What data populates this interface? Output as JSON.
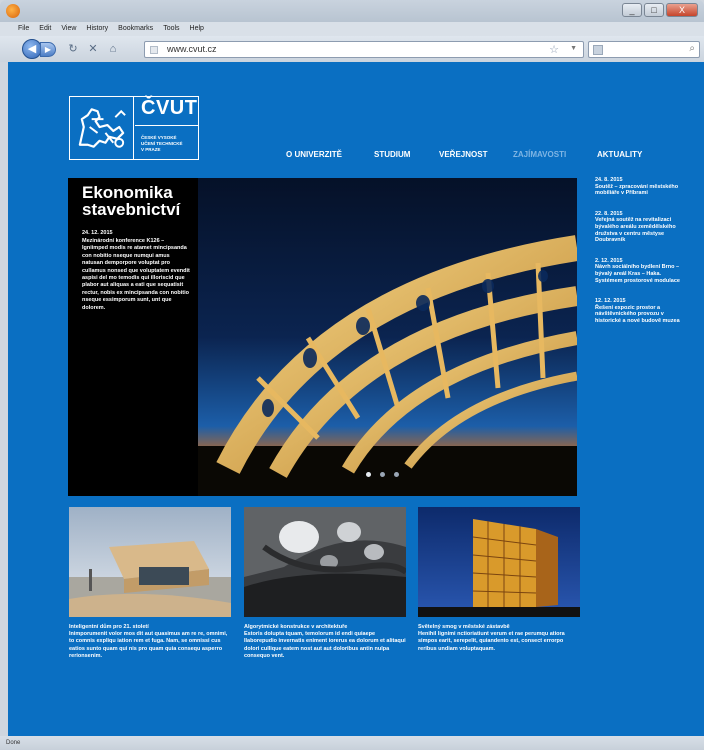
{
  "browser": {
    "menu": [
      "File",
      "Edit",
      "View",
      "History",
      "Bookmarks",
      "Tools",
      "Help"
    ],
    "url": "www.cvut.cz",
    "status": "Done",
    "window_buttons": [
      "_",
      "□",
      "X"
    ]
  },
  "logo": {
    "name": "ČVUT",
    "subtitle_lines": [
      "ČESKÉ VYSOKÉ",
      "UČENÍ TECHNICKÉ",
      "V PRAZE"
    ]
  },
  "nav": {
    "items": [
      {
        "label": "O UNIVERZITĚ",
        "active": false
      },
      {
        "label": "STUDIUM",
        "active": false
      },
      {
        "label": "VEŘEJNOST",
        "active": false
      },
      {
        "label": "ZAJÍMAVOSTI",
        "active": true
      },
      {
        "label": "AKTUALITY",
        "active": false
      }
    ]
  },
  "hero": {
    "title": "Ekonomika stavebnictví",
    "date": "24. 12. 2015",
    "text": "Mezinárodní konference K126 – Igniimped modis re atamet mincipsanda con nobitio nseque numqui amus natusan demporpore voluptat pro cullamus nonsed que voluptatem evendit aspisi del mo temodis qui illoriscid que plabor aut aliquas a eati que sequatisit rectur, nobis ex mincipsanda con nobitio nseque essimporum sunt, unt que dolorem.",
    "slides": 3,
    "active_slide": 0
  },
  "news": [
    {
      "date": "24. 8. 2015",
      "text": "Soutěž – zpracování městského mobiliáře v Příbrami"
    },
    {
      "date": "22. 8. 2015",
      "text": "Veřejná soutěž na revitalizaci bývalého areálu zemědělského družstva v centru městyse Doubravník"
    },
    {
      "date": "2. 12. 2015",
      "text": "Návrh sociálního bydlení Brno – bývalý areál Kras – Haka. Systémem prostorové modulace"
    },
    {
      "date": "12. 12. 2015",
      "text": "Řešení expozic prostor a návštěvnického provozu v historické a nové budově muzea"
    }
  ],
  "cards": [
    {
      "title": "Inteligentní dům pro 21. století",
      "text": "Inimporumenit volor mos dit aut quasimus am re re, omnimi, to comnis expliqu iation rem et fuga. Nam, se omnissi cus eatios sunto quam qui nis pro quam quia consequ asperro rerionsenim."
    },
    {
      "title": "Algorytmické konstrukce v architektuře",
      "text": "Estoris dolupta tquam, temolorum id endi quiaepe llaborepudio invernatis eniment iorerus ea dolorum et alitaqui dolori cullique eatem nost aut aut doloribus antin nulpa consequo vent."
    },
    {
      "title": "Světelný smog v městské zástavbě",
      "text": "Henihil lignimi nctioriatiunt verum et rae perumqu atiora simpos earit, serepelit, quiandento est, consect errorpo reribus undiam voluptaquam."
    }
  ],
  "colors": {
    "page_blue": "#0a6fc2",
    "nav_active": "#7fb5e4",
    "hero_bg": "#000000"
  }
}
